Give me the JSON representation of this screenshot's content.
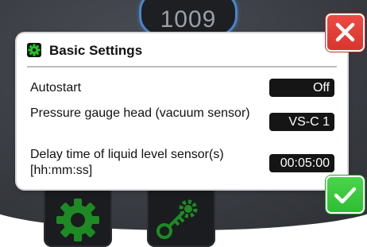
{
  "device": {
    "readout_value": "1009"
  },
  "dialog": {
    "title": "Basic Settings",
    "rows": [
      {
        "label": "Autostart",
        "value": "Off"
      },
      {
        "label": "Pressure gauge head (vacuum sensor)",
        "value": "VS-C 1"
      },
      {
        "label": "Delay time of liquid level sensor(s) [hh:mm:ss]",
        "value": "00:05:00"
      }
    ]
  },
  "actions": {
    "close_icon": "close-x-icon",
    "confirm_icon": "checkmark-icon"
  },
  "background_tiles": [
    "gear-icon",
    "key-gear-icon"
  ],
  "colors": {
    "accent_green": "#20c020",
    "close_red": "#e0403a",
    "confirm_green": "#3cc93e",
    "value_box_bg": "#151515",
    "readout_ring": "#4a86c8"
  }
}
